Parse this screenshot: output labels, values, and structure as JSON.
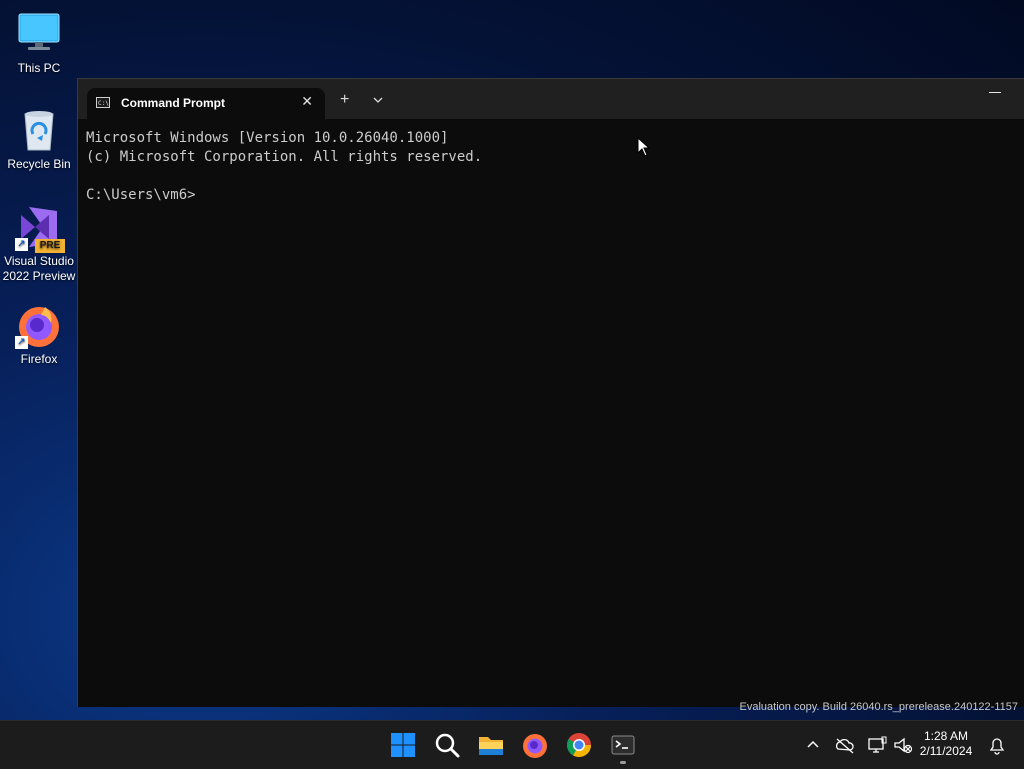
{
  "desktop": {
    "icons": [
      {
        "label": "This PC"
      },
      {
        "label": "Recycle Bin"
      },
      {
        "label": "Visual Studio 2022 Preview",
        "badge": "PRE"
      },
      {
        "label": "Firefox"
      }
    ]
  },
  "window": {
    "tab_title": "Command Prompt",
    "new_tab_symbol": "+",
    "close_symbol": "✕",
    "console_lines": [
      "Microsoft Windows [Version 10.0.26040.1000]",
      "(c) Microsoft Corporation. All rights reserved.",
      "",
      "C:\\Users\\vm6>"
    ]
  },
  "watermark": "Evaluation copy. Build 26040.rs_prerelease.240122-1157",
  "taskbar": {
    "apps": [
      "start-button",
      "search",
      "file-explorer",
      "firefox",
      "chrome",
      "terminal"
    ],
    "clock_time": "1:28 AM",
    "clock_date": "2/11/2024"
  },
  "colors": {
    "accent": "#0078d4",
    "terminal_bg": "#0c0c0c",
    "titlebar_bg": "#202020",
    "taskbar_bg": "#1c1c1c"
  }
}
